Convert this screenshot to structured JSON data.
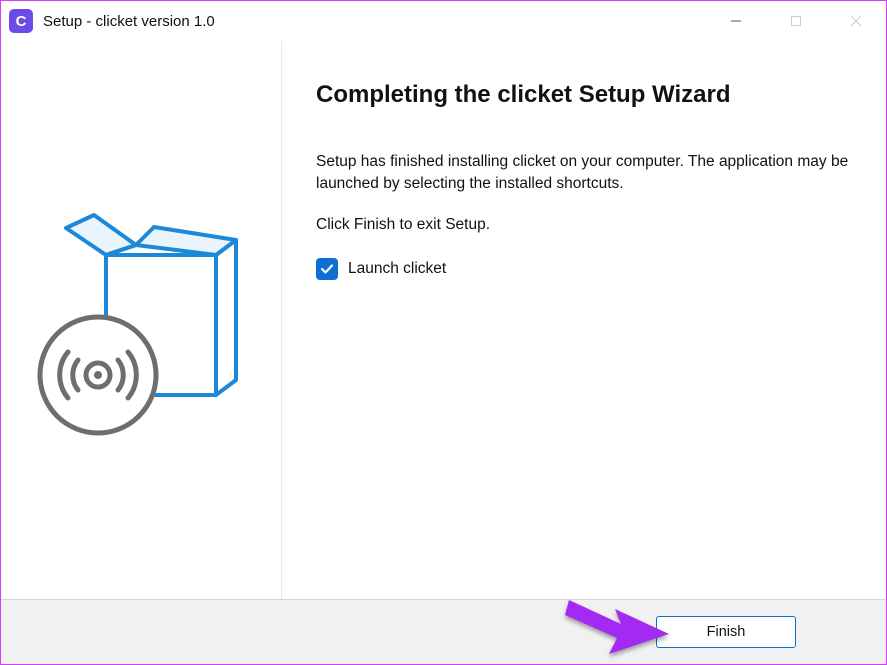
{
  "titlebar": {
    "app_letter": "C",
    "title": "Setup - clicket version 1.0"
  },
  "main": {
    "heading": "Completing the clicket Setup Wizard",
    "paragraph1": "Setup has finished installing clicket on your computer. The application may be launched by selecting the installed shortcuts.",
    "paragraph2": "Click Finish to exit Setup.",
    "checkbox_label": "Launch clicket",
    "checkbox_checked": true
  },
  "footer": {
    "finish_label": "Finish"
  },
  "colors": {
    "accent_blue": "#0d6fd1",
    "arrow_purple": "#a22bf2",
    "box_blue": "#1e88d8",
    "disc_gray": "#6d6e71"
  }
}
